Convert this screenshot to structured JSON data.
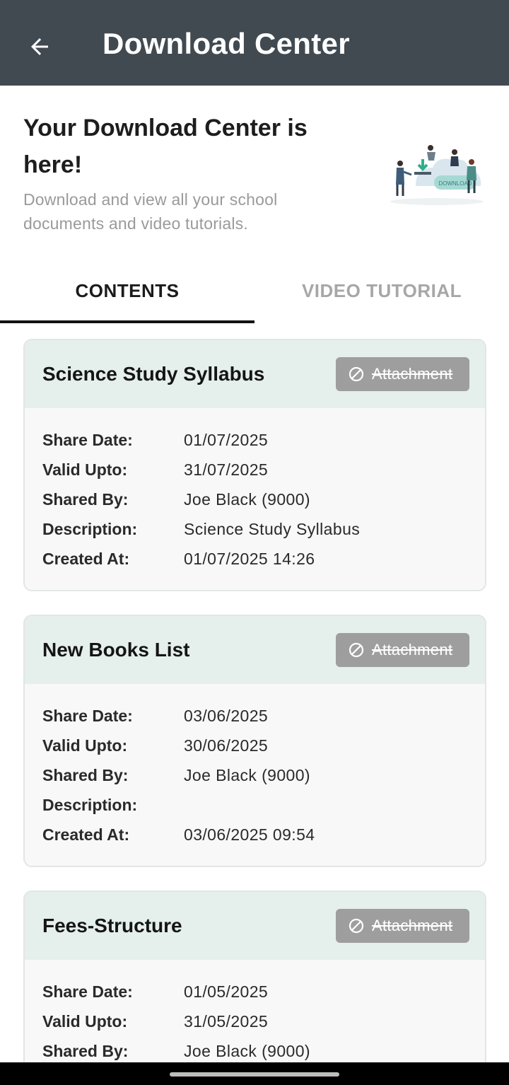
{
  "appbar": {
    "title": "Download Center"
  },
  "hero": {
    "title": "Your Download Center is here!",
    "subtitle": "Download and view all your school documents and video tutorials.",
    "illustration_label": "DOWNLOAD"
  },
  "tabs": [
    {
      "label": "CONTENTS",
      "active": true
    },
    {
      "label": "VIDEO TUTORIAL",
      "active": false
    }
  ],
  "field_labels": {
    "share_date": "Share Date:",
    "valid_upto": "Valid Upto:",
    "shared_by": "Shared By:",
    "description": "Description:",
    "created_at": "Created At:"
  },
  "cards": [
    {
      "title": "Science Study Syllabus",
      "attachment_label": "Attachment",
      "share_date": "01/07/2025",
      "valid_upto": "31/07/2025",
      "shared_by": "Joe Black (9000)",
      "description": "Science Study Syllabus",
      "created_at": "01/07/2025 14:26"
    },
    {
      "title": "New Books List",
      "attachment_label": "Attachment",
      "share_date": "03/06/2025",
      "valid_upto": "30/06/2025",
      "shared_by": "Joe Black (9000)",
      "description": "",
      "created_at": "03/06/2025 09:54"
    },
    {
      "title": "Fees-Structure",
      "attachment_label": "Attachment",
      "share_date": "01/05/2025",
      "valid_upto": "31/05/2025",
      "shared_by": "Joe Black (9000)"
    }
  ],
  "colors": {
    "appbar": "#414a51",
    "card_header": "#e5efec",
    "attachment_button": "#9e9e9e",
    "tab_indicator": "#111111"
  }
}
